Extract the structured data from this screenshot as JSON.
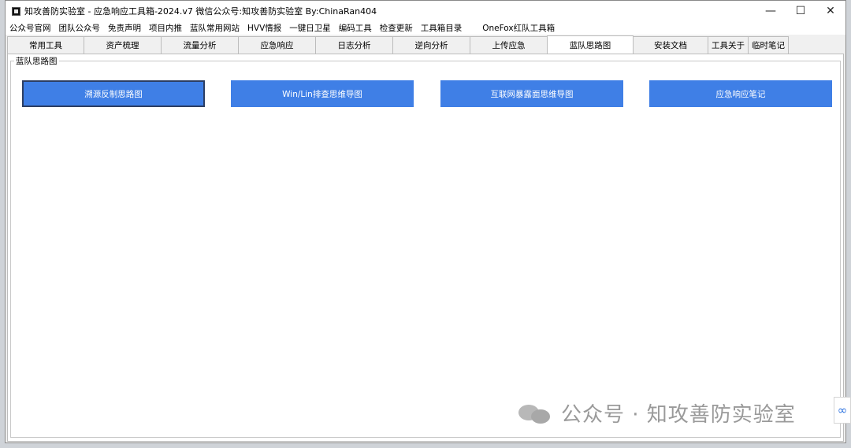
{
  "window": {
    "title": "知攻善防实验室 - 应急响应工具箱-2024.v7   微信公众号:知攻善防实验室   By:ChinaRan404",
    "controls": {
      "minimize": "—",
      "maximize": "☐",
      "close": "✕"
    }
  },
  "menu": {
    "items": [
      "公众号官网",
      "团队公众号",
      "免责声明",
      "项目内推",
      "蓝队常用网站",
      "HVV情报",
      "一键日卫星",
      "编码工具",
      "检查更新",
      "工具箱目录"
    ],
    "extra": "OneFox红队工具箱"
  },
  "tabs": [
    {
      "label": "常用工具"
    },
    {
      "label": "资产梳理"
    },
    {
      "label": "流量分析"
    },
    {
      "label": "应急响应"
    },
    {
      "label": "日志分析"
    },
    {
      "label": "逆向分析"
    },
    {
      "label": "上传应急"
    },
    {
      "label": "蓝队思路图",
      "active": true
    },
    {
      "label": "安装文档"
    },
    {
      "label": "工具关于"
    },
    {
      "label": "临时笔记"
    }
  ],
  "group": {
    "title": "蓝队思路图",
    "buttons": [
      "溯源反制思路图",
      "Win/Lin排查思维导图",
      "互联网暴露面思维导图",
      "应急响应笔记"
    ]
  },
  "watermark": {
    "text": "公众号 · 知攻善防实验室"
  },
  "colors": {
    "button_bg": "#3f7fe6",
    "button_text": "#ffffff",
    "focus_border": "#2c3e63"
  },
  "icons": [
    "app-icon",
    "minimize-icon",
    "maximize-icon",
    "close-icon",
    "wechat-icon",
    "side-share-icon"
  ]
}
